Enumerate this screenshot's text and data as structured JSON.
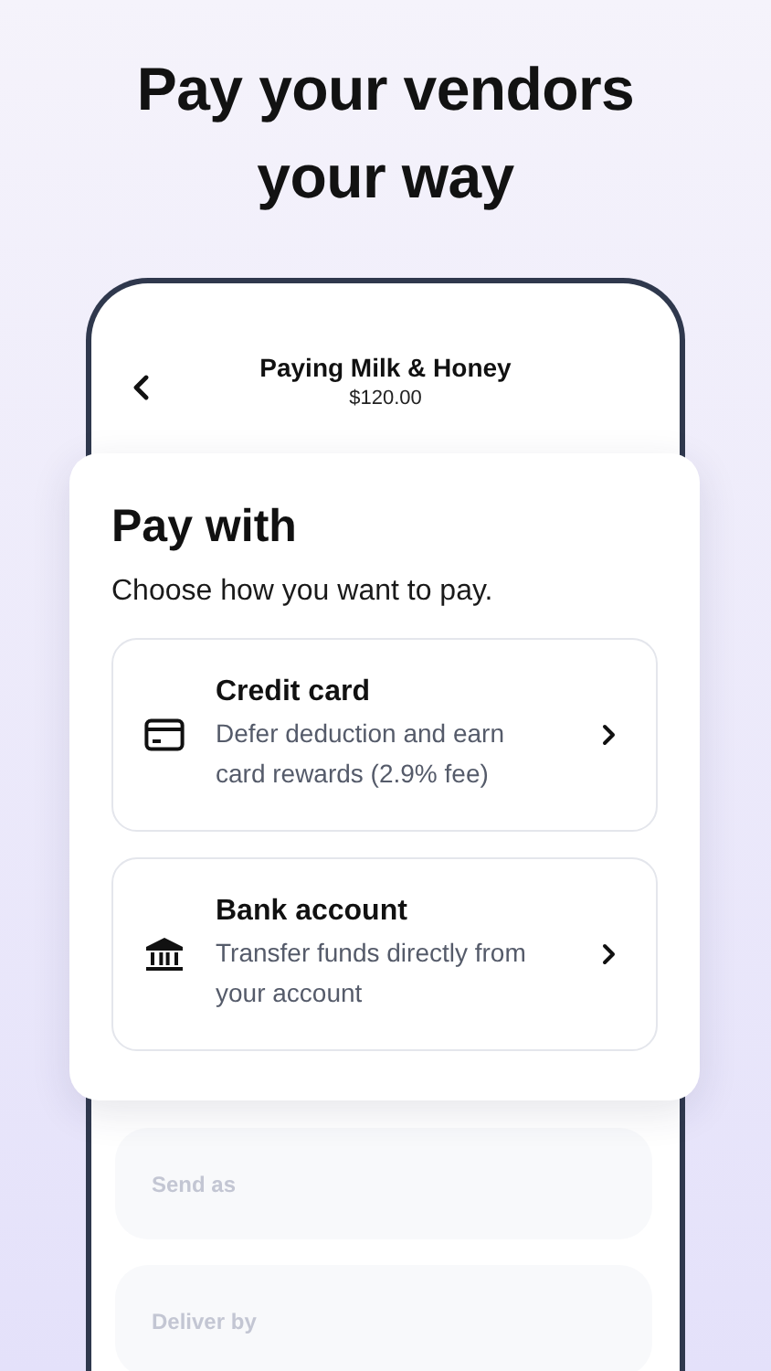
{
  "headline": [
    "Pay your vendors",
    "your way"
  ],
  "header": {
    "title": "Paying Milk & Honey",
    "amount": "$120.00"
  },
  "sheet": {
    "title": "Pay with",
    "subtitle": "Choose how you want to pay.",
    "options": [
      {
        "kind": "card",
        "title": "Credit card",
        "description": "Defer deduction and earn card rewards (2.9% fee)"
      },
      {
        "kind": "bank",
        "title": "Bank account",
        "description": "Transfer funds directly from your account"
      }
    ]
  },
  "fields": [
    {
      "placeholder": "Send as"
    },
    {
      "placeholder": "Deliver by"
    }
  ]
}
